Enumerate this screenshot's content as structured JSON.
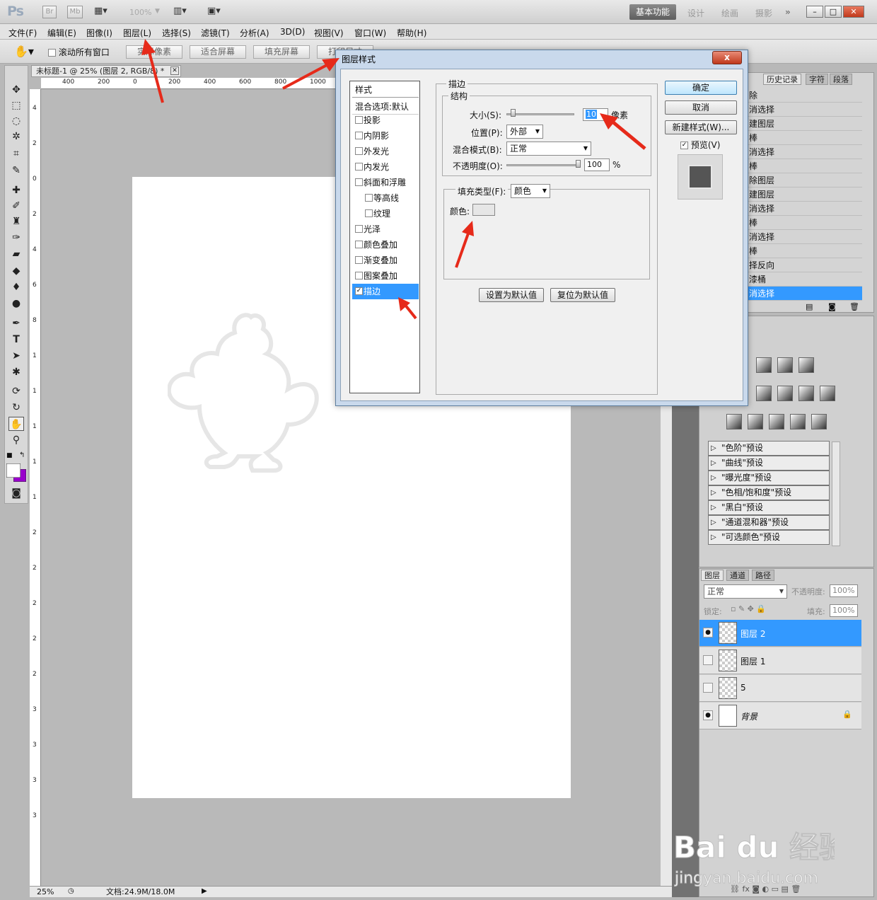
{
  "appbar": {
    "logo": "Ps",
    "br": "Br",
    "mb": "Mb",
    "zoom": "100%",
    "workspace_active": "基本功能",
    "workspaces": [
      "设计",
      "绘画",
      "摄影"
    ],
    "more": "»"
  },
  "menu": [
    "文件(F)",
    "编辑(E)",
    "图像(I)",
    "图层(L)",
    "选择(S)",
    "滤镜(T)",
    "分析(A)",
    "3D(D)",
    "视图(V)",
    "窗口(W)",
    "帮助(H)"
  ],
  "options": {
    "scroll_all": "滚动所有窗口",
    "actual_pixels": "实际像素",
    "fit_screen": "适合屏幕",
    "fill_screen": "填充屏幕",
    "print_size": "打印尺寸"
  },
  "document": {
    "tab_title": "未标题-1 @ 25% (图层 2, RGB/8) *",
    "zoom": "25%",
    "doc_size": "文档:24.9M/18.0M",
    "ruler_top": [
      "400",
      "200",
      "0",
      "200",
      "400",
      "600",
      "800",
      "1000"
    ],
    "ruler_left": [
      "4",
      "2",
      "0",
      "2",
      "4",
      "6",
      "8",
      "1",
      "1",
      "1",
      "1",
      "1",
      "2",
      "2",
      "2",
      "2",
      "2",
      "3",
      "3",
      "3",
      "3"
    ]
  },
  "history": {
    "tabs": [
      "历史记录",
      "字符",
      "段落"
    ],
    "items": [
      "除",
      "消选择",
      "建图层",
      "棒",
      "消选择",
      "棒",
      "除图层",
      "建图层",
      "消选择",
      "棒",
      "消选择",
      "棒",
      "择反向",
      "漆桶",
      "消选择"
    ],
    "selected_index": 14
  },
  "adjustments": {
    "presets": [
      "\"色阶\"预设",
      "\"曲线\"预设",
      "\"曝光度\"预设",
      "\"色相/饱和度\"预设",
      "\"黑白\"预设",
      "\"通道混和器\"预设",
      "\"可选颜色\"预设"
    ]
  },
  "layers": {
    "tabs": [
      "图层",
      "通道",
      "路径"
    ],
    "blend_mode": "正常",
    "opacity_label": "不透明度:",
    "opacity": "100%",
    "lock_label": "锁定:",
    "fill_label": "填充:",
    "fill": "100%",
    "items": [
      {
        "name": "图层 2",
        "visible": true,
        "selected": true
      },
      {
        "name": "图层 1",
        "visible": false,
        "selected": false
      },
      {
        "name": "5",
        "visible": false,
        "selected": false
      },
      {
        "name": "背景",
        "visible": true,
        "selected": false
      }
    ]
  },
  "dialog": {
    "title": "图层样式",
    "close": "x",
    "styles_header": "样式",
    "blend_options": "混合选项:默认",
    "styles": [
      {
        "label": "投影",
        "checked": false,
        "sub": false
      },
      {
        "label": "内阴影",
        "checked": false,
        "sub": false
      },
      {
        "label": "外发光",
        "checked": false,
        "sub": false
      },
      {
        "label": "内发光",
        "checked": false,
        "sub": false
      },
      {
        "label": "斜面和浮雕",
        "checked": false,
        "sub": false
      },
      {
        "label": "等高线",
        "checked": false,
        "sub": true
      },
      {
        "label": "纹理",
        "checked": false,
        "sub": true
      },
      {
        "label": "光泽",
        "checked": false,
        "sub": false
      },
      {
        "label": "颜色叠加",
        "checked": false,
        "sub": false
      },
      {
        "label": "渐变叠加",
        "checked": false,
        "sub": false
      },
      {
        "label": "图案叠加",
        "checked": false,
        "sub": false
      },
      {
        "label": "描边",
        "checked": true,
        "sub": false
      }
    ],
    "stroke_group": "描边",
    "structure_group": "结构",
    "size_label": "大小(S):",
    "size_value": "10",
    "size_unit": "像素",
    "position_label": "位置(P):",
    "position_value": "外部",
    "blend_label": "混合模式(B):",
    "blend_value": "正常",
    "opacity_label": "不透明度(O):",
    "opacity_value": "100",
    "opacity_unit": "%",
    "fill_type_label": "填充类型(F):",
    "fill_type_value": "颜色",
    "color_label": "颜色:",
    "color_swatch": "#e6e6e6",
    "set_default": "设置为默认值",
    "reset_default": "复位为默认值",
    "ok": "确定",
    "cancel": "取消",
    "new_style": "新建样式(W)...",
    "preview_label": "预览(V)",
    "preview_checked": true
  },
  "colors": {
    "selection": "#3399ff",
    "arrow": "#e62a1a",
    "foreground": "#ffffff",
    "background": "#9900cc"
  },
  "watermark": {
    "brand": "Bai du 经验",
    "url": "jingyan.baidu.com"
  }
}
